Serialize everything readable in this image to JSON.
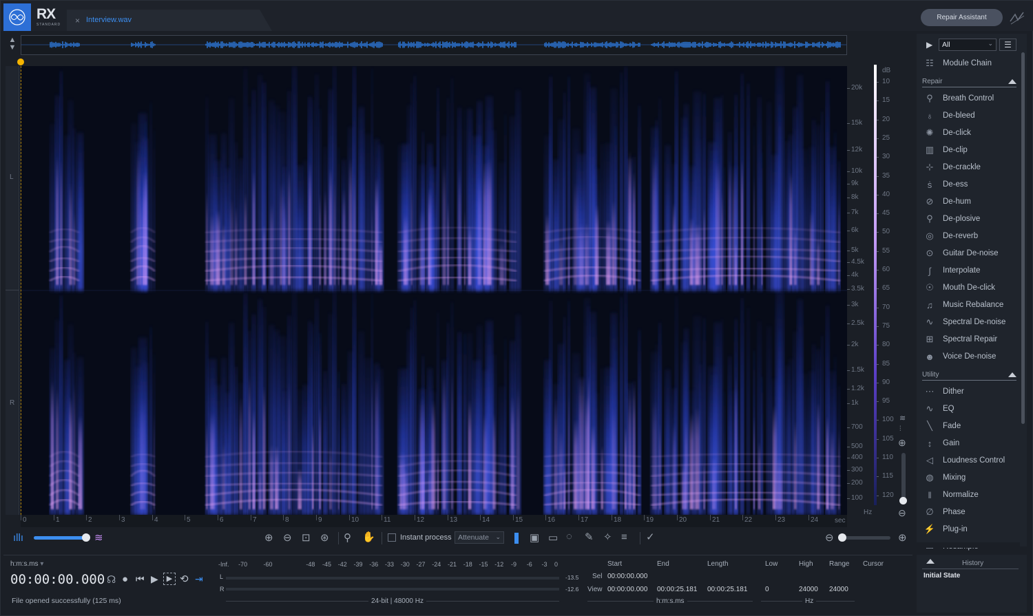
{
  "app": {
    "logo_text": "RX",
    "logo_sub": "STANDARD"
  },
  "tab": {
    "filename": "Interview.wav",
    "close_glyph": "×"
  },
  "header": {
    "repair_assistant": "Repair Assistant"
  },
  "channels": {
    "left": "L",
    "right": "R"
  },
  "timeline": {
    "ticks": [
      "0",
      "1",
      "2",
      "3",
      "4",
      "5",
      "6",
      "7",
      "8",
      "9",
      "10",
      "11",
      "12",
      "13",
      "14",
      "15",
      "16",
      "17",
      "18",
      "19",
      "20",
      "21",
      "22",
      "23",
      "24"
    ],
    "unit": "sec"
  },
  "freq_axis": {
    "labels": [
      "20k",
      "15k",
      "12k",
      "10k",
      "9k",
      "8k",
      "7k",
      "6k",
      "5k",
      "4.5k",
      "4k",
      "3.5k",
      "3k",
      "2.5k",
      "2k",
      "1.5k",
      "1.2k",
      "1k",
      "700",
      "500",
      "400",
      "300",
      "200",
      "100"
    ],
    "unit": "Hz"
  },
  "db_axis": {
    "title": "dB",
    "labels": [
      "10",
      "15",
      "20",
      "25",
      "30",
      "35",
      "40",
      "45",
      "50",
      "55",
      "60",
      "65",
      "70",
      "75",
      "80",
      "85",
      "90",
      "95",
      "100",
      "105",
      "110",
      "115",
      "120"
    ]
  },
  "spec_toolbar": {
    "instant_process": "Instant process",
    "mode": "Attenuate"
  },
  "right_panel": {
    "preset": "All",
    "module_chain": "Module Chain",
    "repair_header": "Repair",
    "repair_items": [
      {
        "label": "Breath Control",
        "icon": "breath-control-icon",
        "glyph": "⚲"
      },
      {
        "label": "De-bleed",
        "icon": "de-bleed-icon",
        "glyph": "♁"
      },
      {
        "label": "De-click",
        "icon": "de-click-icon",
        "glyph": "✺"
      },
      {
        "label": "De-clip",
        "icon": "de-clip-icon",
        "glyph": "▥"
      },
      {
        "label": "De-crackle",
        "icon": "de-crackle-icon",
        "glyph": "⊹"
      },
      {
        "label": "De-ess",
        "icon": "de-ess-icon",
        "glyph": "ṡ"
      },
      {
        "label": "De-hum",
        "icon": "de-hum-icon",
        "glyph": "⊘"
      },
      {
        "label": "De-plosive",
        "icon": "de-plosive-icon",
        "glyph": "⚲"
      },
      {
        "label": "De-reverb",
        "icon": "de-reverb-icon",
        "glyph": "◎"
      },
      {
        "label": "Guitar De-noise",
        "icon": "guitar-icon",
        "glyph": "⊙"
      },
      {
        "label": "Interpolate",
        "icon": "interpolate-icon",
        "glyph": "∫"
      },
      {
        "label": "Mouth De-click",
        "icon": "mouth-icon",
        "glyph": "☉"
      },
      {
        "label": "Music Rebalance",
        "icon": "music-icon",
        "glyph": "♫"
      },
      {
        "label": "Spectral De-noise",
        "icon": "spectral-denoise-icon",
        "glyph": "∿"
      },
      {
        "label": "Spectral Repair",
        "icon": "spectral-repair-icon",
        "glyph": "⊞"
      },
      {
        "label": "Voice De-noise",
        "icon": "voice-icon",
        "glyph": "☻"
      }
    ],
    "utility_header": "Utility",
    "utility_items": [
      {
        "label": "Dither",
        "icon": "dither-icon",
        "glyph": "⋯"
      },
      {
        "label": "EQ",
        "icon": "eq-icon",
        "glyph": "∿"
      },
      {
        "label": "Fade",
        "icon": "fade-icon",
        "glyph": "╲"
      },
      {
        "label": "Gain",
        "icon": "gain-icon",
        "glyph": "↕"
      },
      {
        "label": "Loudness Control",
        "icon": "loudness-icon",
        "glyph": "◁"
      },
      {
        "label": "Mixing",
        "icon": "mixing-icon",
        "glyph": "◍"
      },
      {
        "label": "Normalize",
        "icon": "normalize-icon",
        "glyph": "‖"
      },
      {
        "label": "Phase",
        "icon": "phase-icon",
        "glyph": "∅"
      },
      {
        "label": "Plug-in",
        "icon": "plugin-icon",
        "glyph": "⚡"
      },
      {
        "label": "Resample",
        "icon": "resample-icon",
        "glyph": "▭"
      }
    ]
  },
  "transport": {
    "format": "h:m:s.ms",
    "time": "00:00:00.000",
    "status": "File opened successfully (125 ms)"
  },
  "meter": {
    "scale": [
      "-Inf.",
      "-70",
      "-60",
      "-48",
      "-45",
      "-42",
      "-39",
      "-36",
      "-33",
      "-30",
      "-27",
      "-24",
      "-21",
      "-18",
      "-15",
      "-12",
      "-9",
      "-6",
      "-3",
      "0"
    ],
    "left_peak": "-13.5",
    "right_peak": "-12.6",
    "format": "24-bit | 48000 Hz"
  },
  "selection": {
    "start_label": "Start",
    "end_label": "End",
    "length_label": "Length",
    "low_label": "Low",
    "high_label": "High",
    "range_label": "Range",
    "cursor_label": "Cursor",
    "sel_label": "Sel",
    "view_label": "View",
    "sel_start": "00:00:00.000",
    "view_start": "00:00:00.000",
    "view_end": "00:00:25.181",
    "view_length": "00:00:25.181",
    "low": "0",
    "high": "24000",
    "range": "24000",
    "time_unit": "h:m:s.ms",
    "freq_unit": "Hz"
  },
  "history": {
    "title": "History",
    "items": [
      "Initial State"
    ]
  },
  "colors": {
    "accent": "#3c8ef0",
    "playhead": "#f5b400",
    "spectrum_hot": "#d88cf0",
    "spectrum_mid": "#3a4fd8"
  }
}
